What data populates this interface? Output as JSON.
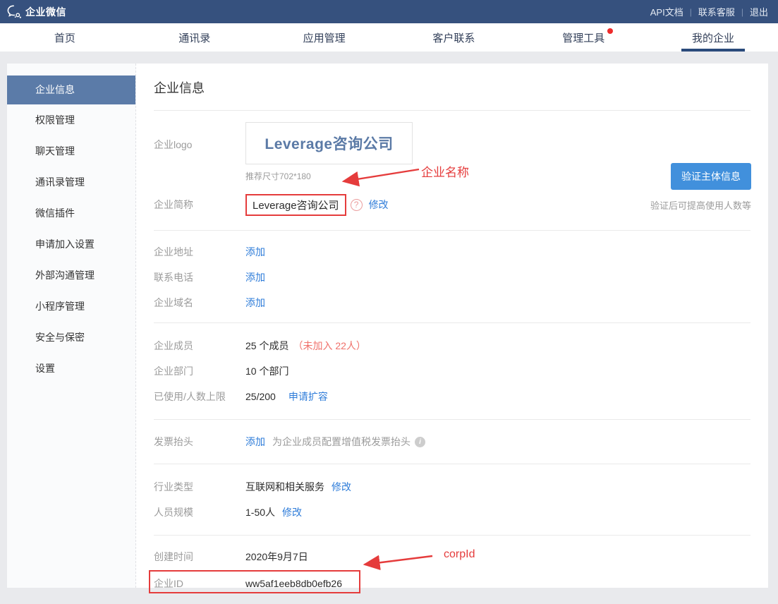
{
  "topbar": {
    "brand": "企业微信",
    "links": [
      {
        "label": "API文档"
      },
      {
        "label": "联系客服"
      },
      {
        "label": "退出"
      }
    ]
  },
  "nav": {
    "tabs": [
      {
        "label": "首页"
      },
      {
        "label": "通讯录"
      },
      {
        "label": "应用管理"
      },
      {
        "label": "客户联系"
      },
      {
        "label": "管理工具",
        "has_badge": true
      },
      {
        "label": "我的企业",
        "active": true
      }
    ]
  },
  "sidebar": {
    "items": [
      {
        "label": "企业信息",
        "active": true
      },
      {
        "label": "权限管理"
      },
      {
        "label": "聊天管理"
      },
      {
        "label": "通讯录管理"
      },
      {
        "label": "微信插件"
      },
      {
        "label": "申请加入设置"
      },
      {
        "label": "外部沟通管理"
      },
      {
        "label": "小程序管理"
      },
      {
        "label": "安全与保密"
      },
      {
        "label": "设置"
      }
    ]
  },
  "main": {
    "title": "企业信息",
    "logo_row": {
      "label": "企业logo",
      "logo_text": "Leverage咨询公司",
      "size_hint": "推荐尺寸702*180"
    },
    "shortname_row": {
      "label": "企业简称",
      "value": "Leverage咨询公司",
      "help_glyph": "?",
      "edit_link": "修改"
    },
    "verify": {
      "button_label": "验证主体信息",
      "hint": "验证后可提高使用人数等"
    },
    "address_row": {
      "label": "企业地址",
      "link": "添加"
    },
    "phone_row": {
      "label": "联系电话",
      "link": "添加"
    },
    "domain_row": {
      "label": "企业域名",
      "link": "添加"
    },
    "members_row": {
      "label": "企业成员",
      "value": "25 个成员",
      "note": "（未加入 22人）"
    },
    "departments_row": {
      "label": "企业部门",
      "value": "10 个部门"
    },
    "capacity_row": {
      "label": "已使用/人数上限",
      "value": "25/200",
      "link": "申请扩容"
    },
    "invoice_row": {
      "label": "发票抬头",
      "link": "添加",
      "desc": "为企业成员配置增值税发票抬头",
      "info_glyph": "i"
    },
    "industry_row": {
      "label": "行业类型",
      "value": "互联网和相关服务",
      "edit_link": "修改"
    },
    "scale_row": {
      "label": "人员规模",
      "value": "1-50人",
      "edit_link": "修改"
    },
    "created_row": {
      "label": "创建时间",
      "value": "2020年9月7日"
    },
    "corpid_row": {
      "label": "企业ID",
      "value": "ww5af1eeb8db0efb26"
    }
  },
  "annotations": {
    "company_name_label": "企业名称",
    "corpid_label": "corpId",
    "color": "#e53c3c"
  },
  "colors": {
    "topbar_bg": "#36517e",
    "nav_active_underline": "#2a4a7b",
    "sidebar_active_bg": "#5b7ba8",
    "link_blue": "#2e7cd9",
    "button_blue": "#4190dc",
    "annotation_red": "#e53c3c",
    "warning_red": "#f0716b",
    "logo_text_blue": "#5b7aa6"
  }
}
